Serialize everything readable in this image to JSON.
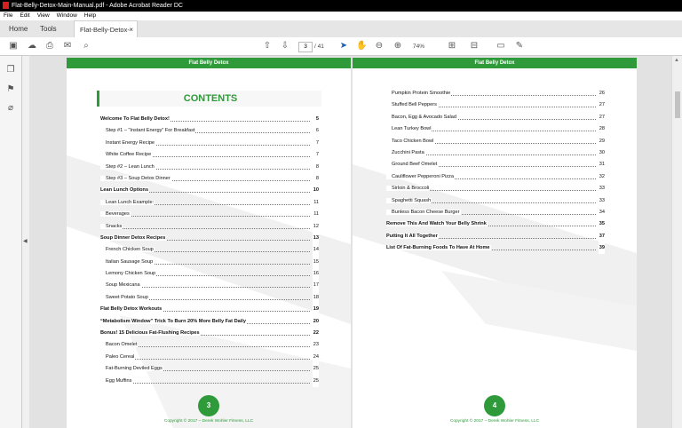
{
  "window": {
    "title": "Flat-Belly-Detox-Main-Manual.pdf - Adobe Acrobat Reader DC"
  },
  "menu": [
    "File",
    "Edit",
    "View",
    "Window",
    "Help"
  ],
  "tabs": {
    "home": "Home",
    "tools": "Tools",
    "document": "Flat-Belly-Detox-M..."
  },
  "toolbar": {
    "page_current": "3",
    "page_total": "/ 41",
    "zoom": "74%"
  },
  "left_page": {
    "header": "Flat Belly Detox",
    "toc_title": "CONTENTS",
    "entries": [
      {
        "label": "Welcome To Flat Belly Detox!",
        "page": "5",
        "bold": true
      },
      {
        "label": "Step #1 – “Instant Energy” For Breakfast",
        "page": "6",
        "bold": false
      },
      {
        "label": "Instant Energy Recipe",
        "page": "7",
        "bold": false
      },
      {
        "label": "White Coffee Recipe",
        "page": "7",
        "bold": false
      },
      {
        "label": "Step #2 – Lean Lunch",
        "page": "8",
        "bold": false
      },
      {
        "label": "Step #3 – Soup Detox Dinner",
        "page": "8",
        "bold": false
      },
      {
        "label": "Lean Lunch Options",
        "page": "10",
        "bold": true
      },
      {
        "label": "Lean Lunch Example:",
        "page": "11",
        "bold": false
      },
      {
        "label": "Beverages",
        "page": "11",
        "bold": false
      },
      {
        "label": "Snacks",
        "page": "12",
        "bold": false
      },
      {
        "label": "Soup Dinner Detox Recipes",
        "page": "13",
        "bold": true
      },
      {
        "label": "French Chicken Soup",
        "page": "14",
        "bold": false
      },
      {
        "label": "Italian Sausage Soup",
        "page": "15",
        "bold": false
      },
      {
        "label": "Lemony Chicken Soup",
        "page": "16",
        "bold": false
      },
      {
        "label": "Soup Mexicana",
        "page": "17",
        "bold": false
      },
      {
        "label": "Sweet Potato Soup",
        "page": "18",
        "bold": false
      },
      {
        "label": "Flat Belly Detox Workouts",
        "page": "19",
        "bold": true
      },
      {
        "label": "“Metabolism Window” Trick To Burn 20% More Belly Fat Daily",
        "page": "20",
        "bold": true
      },
      {
        "label": "Bonus! 15 Delicious Fat-Flushing Recipes",
        "page": "22",
        "bold": true
      },
      {
        "label": "Bacon Omelet",
        "page": "23",
        "bold": false
      },
      {
        "label": "Paleo Cereal",
        "page": "24",
        "bold": false
      },
      {
        "label": "Fat-Burning Deviled Eggs",
        "page": "25",
        "bold": false
      },
      {
        "label": "Egg Muffins",
        "page": "25",
        "bold": false
      }
    ],
    "page_number": "3",
    "copyright": "Copyright © 2017 – Derek Wohler Fitness, LLC"
  },
  "right_page": {
    "header": "Flat Belly Detox",
    "entries": [
      {
        "label": "Pumpkin Protein Smoothie",
        "page": "26",
        "bold": false
      },
      {
        "label": "Stuffed Bell Peppers",
        "page": "27",
        "bold": false
      },
      {
        "label": "Bacon, Egg & Avocado Salad",
        "page": "27",
        "bold": false
      },
      {
        "label": "Lean Turkey Bowl",
        "page": "28",
        "bold": false
      },
      {
        "label": "Taco Chicken Bowl",
        "page": "29",
        "bold": false
      },
      {
        "label": "Zucchini Pasta",
        "page": "30",
        "bold": false
      },
      {
        "label": "Ground Beef Omelet",
        "page": "31",
        "bold": false
      },
      {
        "label": "Cauliflower Pepperoni Pizza",
        "page": "32",
        "bold": false
      },
      {
        "label": "Sirloin & Broccoli",
        "page": "33",
        "bold": false
      },
      {
        "label": "Spaghetti Squash",
        "page": "33",
        "bold": false
      },
      {
        "label": "Bunless Bacon Cheese Burger",
        "page": "34",
        "bold": false
      },
      {
        "label": "Remove This And Watch Your Belly Shrink",
        "page": "35",
        "bold": true
      },
      {
        "label": "Putting It All Together",
        "page": "37",
        "bold": true
      },
      {
        "label": "List Of Fat-Burning Foods To Have At Home",
        "page": "39",
        "bold": true
      }
    ],
    "page_number": "4",
    "copyright": "Copyright © 2017 – Derek Wohler Fitness, LLC"
  },
  "colors": {
    "accent_green": "#2e9a3a"
  }
}
